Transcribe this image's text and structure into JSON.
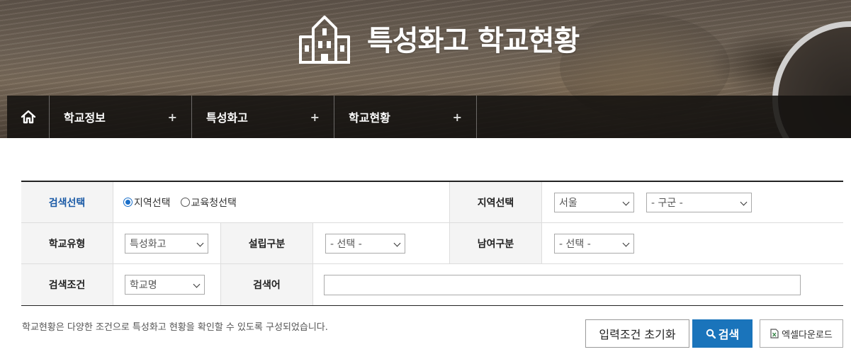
{
  "header": {
    "title": "특성화고 학교현황"
  },
  "nav": {
    "home_icon": "home-icon",
    "crumbs": [
      {
        "label": "학교정보",
        "expand": "+"
      },
      {
        "label": "특성화고",
        "expand": "+"
      },
      {
        "label": "학교현황",
        "expand": "+"
      }
    ]
  },
  "form": {
    "search_select": {
      "label": "검색선택",
      "options": [
        {
          "label": "지역선택",
          "checked": true
        },
        {
          "label": "교육청선택",
          "checked": false
        }
      ]
    },
    "region": {
      "label": "지역선택",
      "city": "서울",
      "district": "- 구군 -"
    },
    "school_type": {
      "label": "학교유형",
      "value": "특성화고"
    },
    "foundation": {
      "label": "설립구분",
      "value": "- 선택 -"
    },
    "gender": {
      "label": "남여구분",
      "value": "- 선택 -"
    },
    "condition": {
      "label": "검색조건",
      "value": "학교명"
    },
    "keyword": {
      "label": "검색어",
      "value": "",
      "placeholder": ""
    }
  },
  "notice": "학교현황은 다양한 조건으로 특성화고 현황을 확인할 수 있도록 구성되었습니다.",
  "buttons": {
    "reset": "입력조건 초기화",
    "search": "검색",
    "excel": "엑셀다운로드"
  },
  "colors": {
    "accent": "#1a74bb",
    "label_blue": "#1a5aa6"
  }
}
